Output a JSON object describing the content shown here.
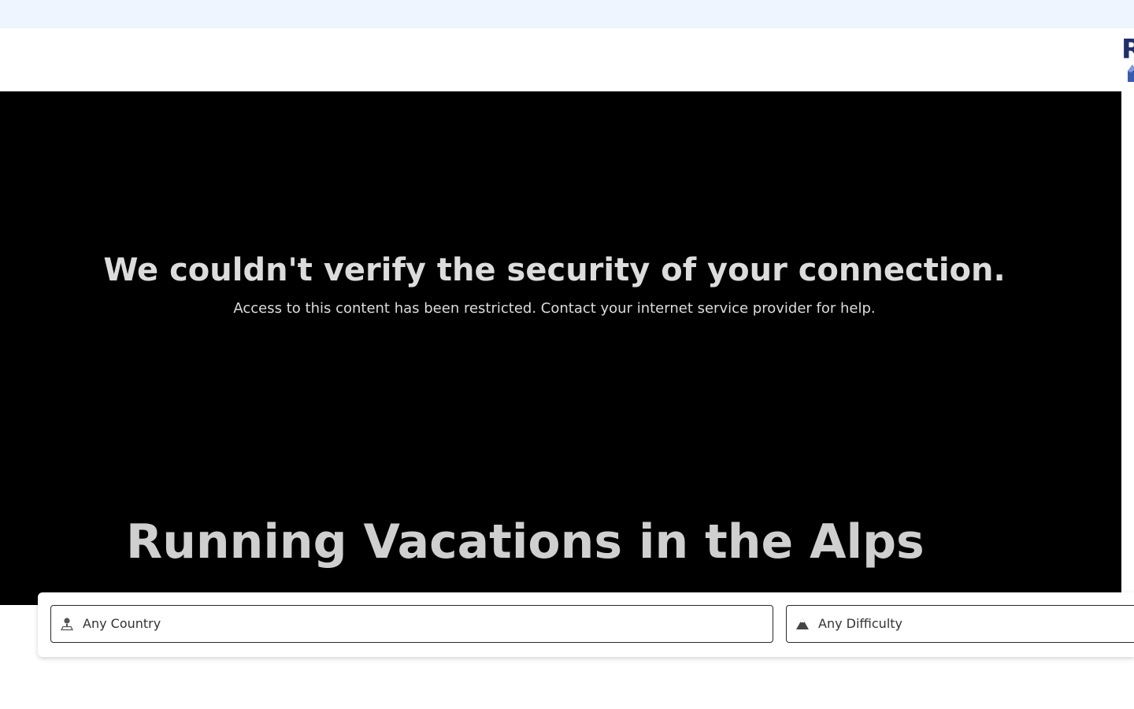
{
  "header": {
    "logo_text": "R"
  },
  "hero": {
    "error_title": "We couldn't verify the security of your connection.",
    "error_message": "Access to this content has been restricted. Contact your internet service provider for help.",
    "title": "Running Vacations in the Alps"
  },
  "filters": {
    "country": {
      "label": "Any Country",
      "icon": "map-pin-icon"
    },
    "difficulty": {
      "label": "Any Difficulty",
      "icon": "mountain-icon"
    }
  },
  "colors": {
    "top_strip": "#eef5ff",
    "logo": "#1f2f6b",
    "hero_background": "#000000",
    "hero_text": "#dcdcdc"
  }
}
